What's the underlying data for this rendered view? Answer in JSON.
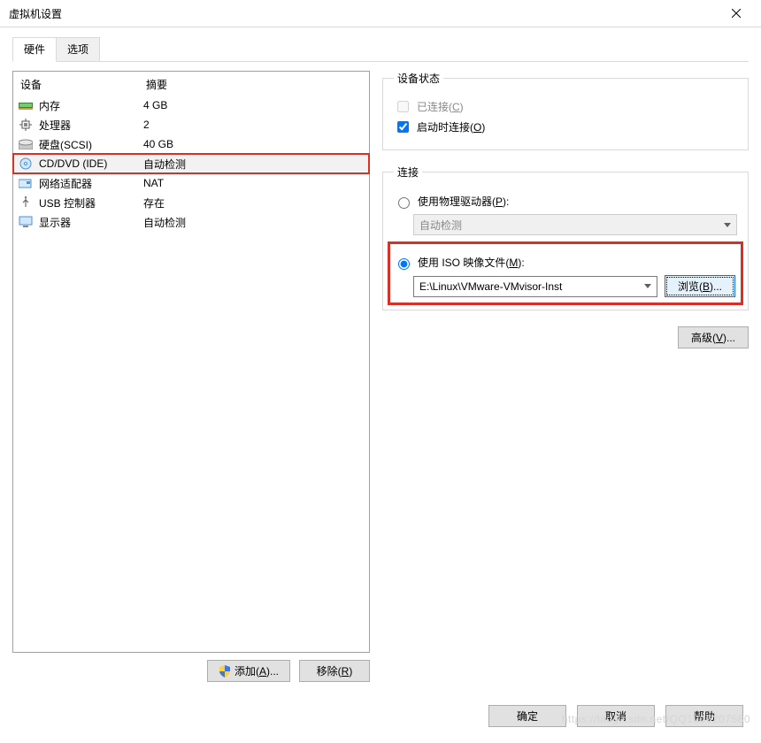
{
  "window": {
    "title": "虚拟机设置"
  },
  "tabs": {
    "hardware": "硬件",
    "options": "选项"
  },
  "device_list": {
    "headers": {
      "device": "设备",
      "summary": "摘要"
    },
    "items": [
      {
        "icon": "memory-icon",
        "name": "内存",
        "summary": "4 GB"
      },
      {
        "icon": "cpu-icon",
        "name": "处理器",
        "summary": "2"
      },
      {
        "icon": "disk-icon",
        "name": "硬盘(SCSI)",
        "summary": "40 GB"
      },
      {
        "icon": "cd-icon",
        "name": "CD/DVD (IDE)",
        "summary": "自动检测"
      },
      {
        "icon": "nic-icon",
        "name": "网络适配器",
        "summary": "NAT"
      },
      {
        "icon": "usb-icon",
        "name": "USB 控制器",
        "summary": "存在"
      },
      {
        "icon": "display-icon",
        "name": "显示器",
        "summary": "自动检测"
      }
    ],
    "selected_index": 3
  },
  "left_buttons": {
    "add": "添加(A)...",
    "remove": "移除(R)"
  },
  "device_status": {
    "legend": "设备状态",
    "connected": "已连接(C)",
    "connect_at_start": "启动时连接(O)",
    "connected_checked": false,
    "connect_at_start_checked": true
  },
  "connection": {
    "legend": "连接",
    "use_physical": "使用物理驱动器(P):",
    "physical_value": "自动检测",
    "use_iso": "使用 ISO 映像文件(M):",
    "iso_path": "E:\\Linux\\VMware-VMvisor-Inst",
    "browse": "浏览(B)...",
    "selected": "iso"
  },
  "advanced_button": "高级(V)...",
  "dialog_buttons": {
    "ok": "确定",
    "cancel": "取消",
    "help": "帮助"
  },
  "watermark": "https://blog.csdn.net/QQ1006207580"
}
